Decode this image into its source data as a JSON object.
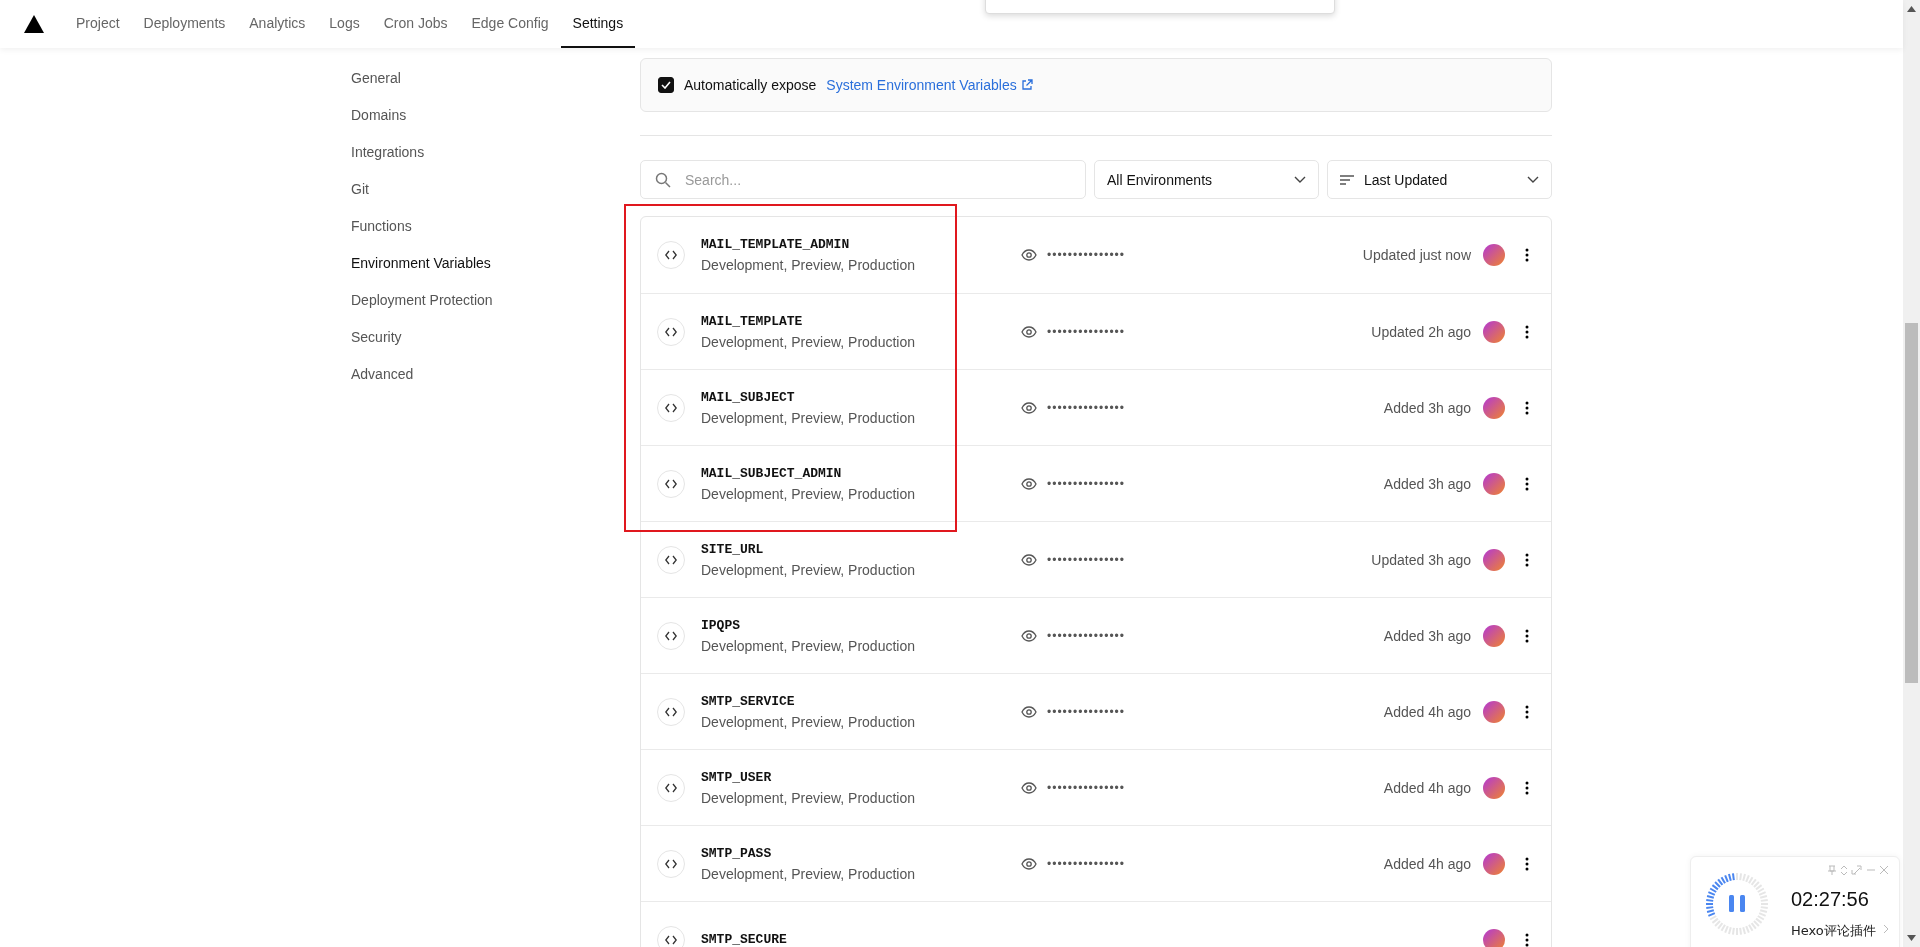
{
  "nav": {
    "tabs": [
      {
        "label": "Project",
        "selected": false
      },
      {
        "label": "Deployments",
        "selected": false
      },
      {
        "label": "Analytics",
        "selected": false
      },
      {
        "label": "Logs",
        "selected": false
      },
      {
        "label": "Cron Jobs",
        "selected": false
      },
      {
        "label": "Edge Config",
        "selected": false
      },
      {
        "label": "Settings",
        "selected": true
      }
    ]
  },
  "sidebar": {
    "items": [
      {
        "label": "General",
        "selected": false
      },
      {
        "label": "Domains",
        "selected": false
      },
      {
        "label": "Integrations",
        "selected": false
      },
      {
        "label": "Git",
        "selected": false
      },
      {
        "label": "Functions",
        "selected": false
      },
      {
        "label": "Environment Variables",
        "selected": true
      },
      {
        "label": "Deployment Protection",
        "selected": false
      },
      {
        "label": "Security",
        "selected": false
      },
      {
        "label": "Advanced",
        "selected": false
      }
    ]
  },
  "expose": {
    "checked": true,
    "text": "Automatically expose",
    "link": "System Environment Variables"
  },
  "filters": {
    "search": {
      "placeholder": "Search..."
    },
    "environment": "All Environments",
    "sort": "Last Updated"
  },
  "variables": [
    {
      "name": "MAIL_TEMPLATE_ADMIN",
      "environments": "Development, Preview, Production",
      "value": "•••••••••••••••",
      "updated": "Updated just now"
    },
    {
      "name": "MAIL_TEMPLATE",
      "environments": "Development, Preview, Production",
      "value": "•••••••••••••••",
      "updated": "Updated 2h ago"
    },
    {
      "name": "MAIL_SUBJECT",
      "environments": "Development, Preview, Production",
      "value": "•••••••••••••••",
      "updated": "Added 3h ago"
    },
    {
      "name": "MAIL_SUBJECT_ADMIN",
      "environments": "Development, Preview, Production",
      "value": "•••••••••••••••",
      "updated": "Added 3h ago"
    },
    {
      "name": "SITE_URL",
      "environments": "Development, Preview, Production",
      "value": "•••••••••••••••",
      "updated": "Updated 3h ago"
    },
    {
      "name": "IPQPS",
      "environments": "Development, Preview, Production",
      "value": "•••••••••••••••",
      "updated": "Added 3h ago"
    },
    {
      "name": "SMTP_SERVICE",
      "environments": "Development, Preview, Production",
      "value": "•••••••••••••••",
      "updated": "Added 4h ago"
    },
    {
      "name": "SMTP_USER",
      "environments": "Development, Preview, Production",
      "value": "•••••••••••••••",
      "updated": "Added 4h ago"
    },
    {
      "name": "SMTP_PASS",
      "environments": "Development, Preview, Production",
      "value": "•••••••••••••••",
      "updated": "Added 4h ago"
    },
    {
      "name": "SMTP_SECURE"
    }
  ],
  "annotation": {
    "kind": "highlight-box"
  },
  "timer_widget": {
    "time": "02:27:56",
    "label": "Hexo评论插件"
  }
}
